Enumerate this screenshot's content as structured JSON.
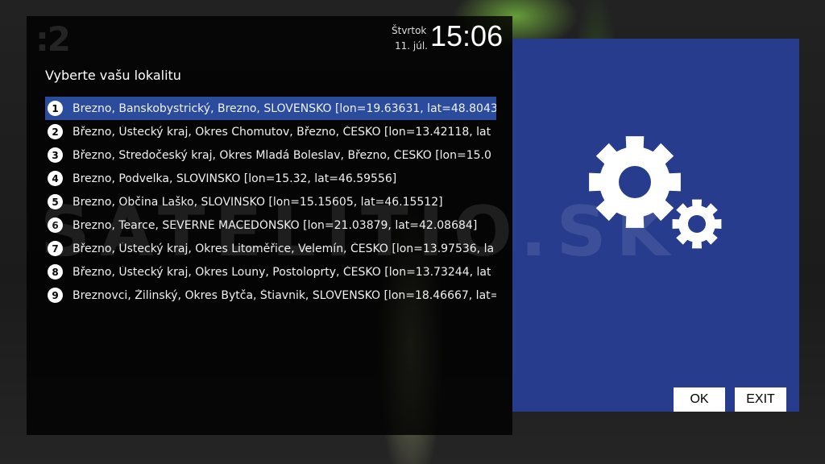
{
  "clock": {
    "day": "Štvrtok",
    "date": "11. júl.",
    "time": "15:06"
  },
  "channel_logo": ":2",
  "dialog": {
    "title": "Vyberte vašu lokalitu",
    "selected_index": 0,
    "items": [
      {
        "num": "1",
        "label": "Brezno, Banskobystrický, Brezno, SLOVENSKO [lon=19.63631, lat=48.8043"
      },
      {
        "num": "2",
        "label": "Březno, Ústecký kraj, Okres Chomutov, Březno, ČESKO [lon=13.42118, lat"
      },
      {
        "num": "3",
        "label": "Březno, Stredočeský kraj, Okres Mladá Boleslav, Březno, ČESKO [lon=15.0"
      },
      {
        "num": "4",
        "label": "Brezno, Podvelka, SLOVINSKO [lon=15.32, lat=46.59556]"
      },
      {
        "num": "5",
        "label": "Brezno, Občina Laško, SLOVINSKO [lon=15.15605, lat=46.15512]"
      },
      {
        "num": "6",
        "label": "Brezno, Tearce, SEVERNÉ MACEDÓNSKO [lon=21.03879, lat=42.08684]"
      },
      {
        "num": "7",
        "label": "Březno, Ústecký kraj, Okres Litoměřice, Velemín, ČESKO [lon=13.97536, la"
      },
      {
        "num": "8",
        "label": "Březno, Ústecký kraj, Okres Louny, Postoloprty, ČESKO [lon=13.73244, lat"
      },
      {
        "num": "9",
        "label": "Breznovci, Žilinský, Okres Bytča, Štiavnik, SLOVENSKO [lon=18.46667, lat="
      }
    ]
  },
  "buttons": {
    "ok": "OK",
    "exit": "EXIT"
  },
  "watermark": "SATELITIO.SK",
  "colors": {
    "highlight": "#2b4b9c",
    "side_panel": "#283c8d"
  },
  "icons": {
    "settings": "gears-icon"
  }
}
